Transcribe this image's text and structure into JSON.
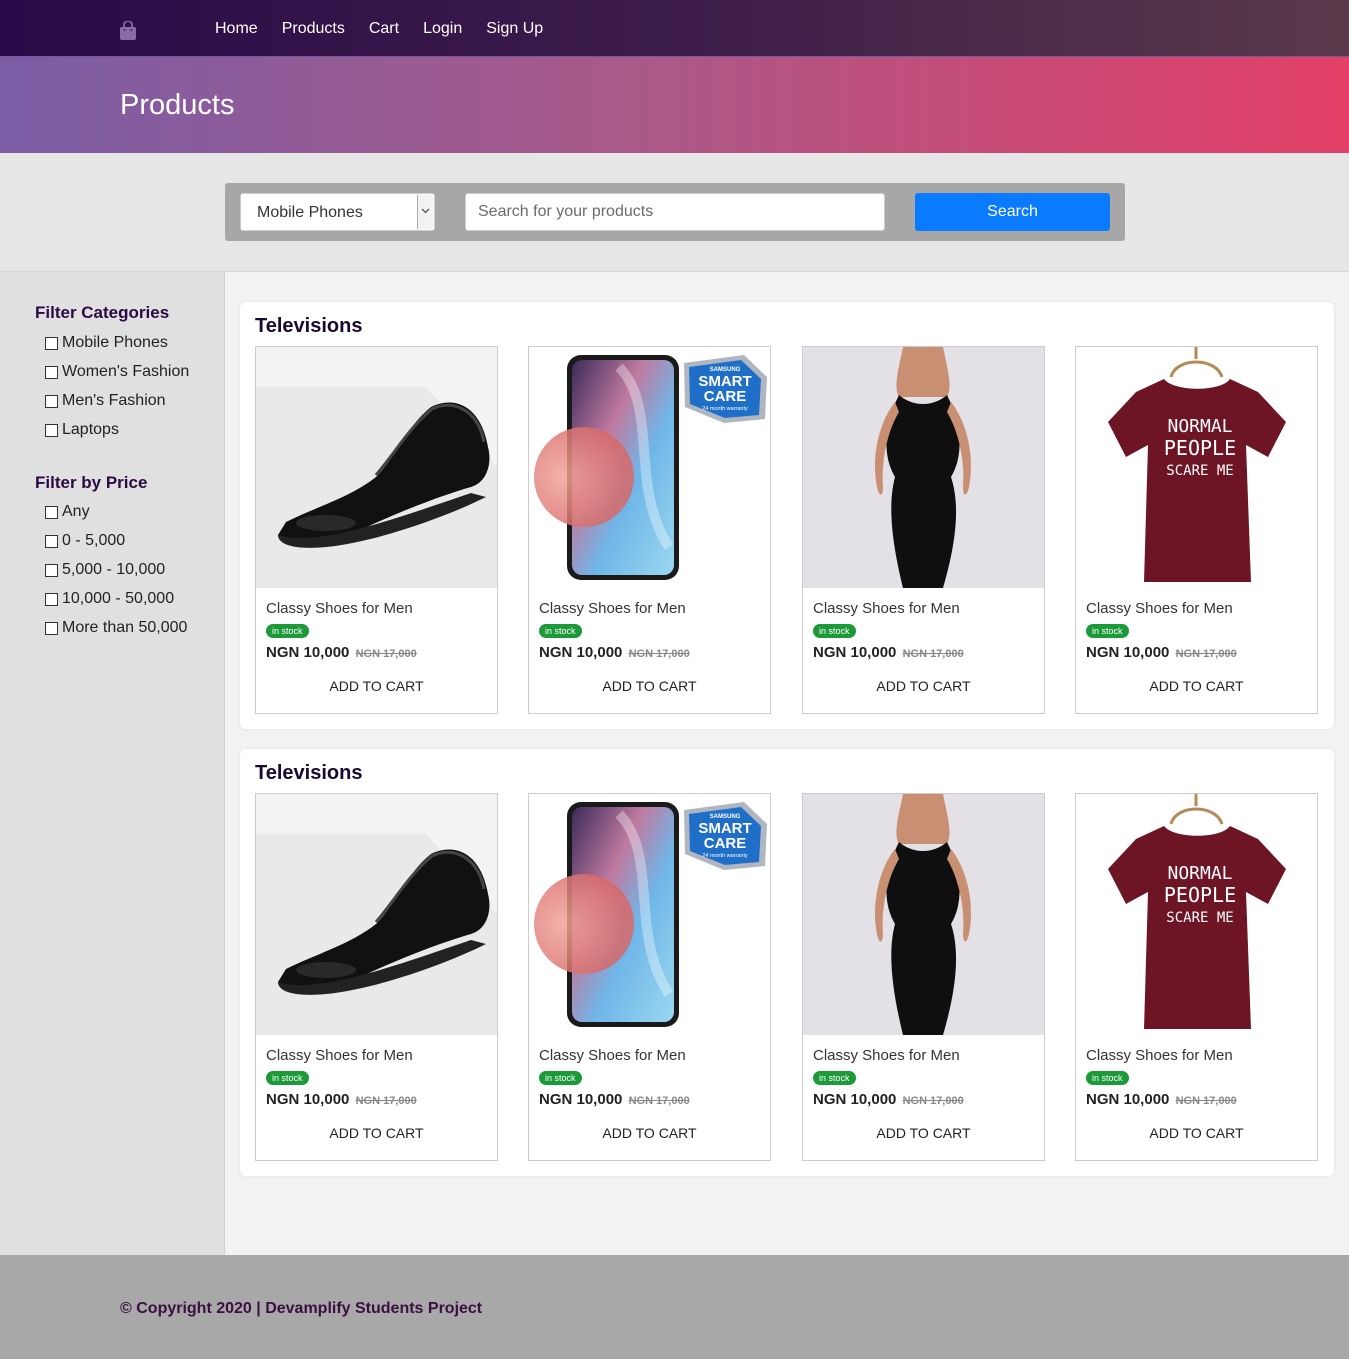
{
  "nav": {
    "logo_icon": "shopping-bag-icon",
    "links": [
      "Home",
      "Products",
      "Cart",
      "Login",
      "Sign Up"
    ]
  },
  "hero": {
    "title": "Products"
  },
  "search": {
    "category_selected": "Mobile Phones",
    "placeholder": "Search for your products",
    "button_label": "Search"
  },
  "sidebar": {
    "categories_title": "Filter Categories",
    "categories": [
      "Mobile Phones",
      "Women's Fashion",
      "Men's Fashion",
      "Laptops"
    ],
    "price_title": "Filter by Price",
    "prices": [
      "Any",
      "0 - 5,000",
      "5,000 - 10,000",
      "10,000 - 50,000",
      "More than 50,000"
    ]
  },
  "sections": [
    {
      "title": "Televisions",
      "products": [
        {
          "image": "black-shoe",
          "name": "Classy Shoes for Men",
          "badge": "in stock",
          "price": "NGN 10,000",
          "old_price": "NGN 17,000",
          "action": "ADD TO CART"
        },
        {
          "image": "samsung-phone",
          "name": "Classy Shoes for Men",
          "badge": "in stock",
          "price": "NGN 10,000",
          "old_price": "NGN 17,000",
          "action": "ADD TO CART"
        },
        {
          "image": "black-dress",
          "name": "Classy Shoes for Men",
          "badge": "in stock",
          "price": "NGN 10,000",
          "old_price": "NGN 17,000",
          "action": "ADD TO CART"
        },
        {
          "image": "maroon-tshirt",
          "name": "Classy Shoes for Men",
          "badge": "in stock",
          "price": "NGN 10,000",
          "old_price": "NGN 17,000",
          "action": "ADD TO CART"
        }
      ]
    },
    {
      "title": "Televisions",
      "products": [
        {
          "image": "black-shoe",
          "name": "Classy Shoes for Men",
          "badge": "in stock",
          "price": "NGN 10,000",
          "old_price": "NGN 17,000",
          "action": "ADD TO CART"
        },
        {
          "image": "samsung-phone",
          "name": "Classy Shoes for Men",
          "badge": "in stock",
          "price": "NGN 10,000",
          "old_price": "NGN 17,000",
          "action": "ADD TO CART"
        },
        {
          "image": "black-dress",
          "name": "Classy Shoes for Men",
          "badge": "in stock",
          "price": "NGN 10,000",
          "old_price": "NGN 17,000",
          "action": "ADD TO CART"
        },
        {
          "image": "maroon-tshirt",
          "name": "Classy Shoes for Men",
          "badge": "in stock",
          "price": "NGN 10,000",
          "old_price": "NGN 17,000",
          "action": "ADD TO CART"
        }
      ]
    }
  ],
  "phone_badge": {
    "line1": "SAMSUNG",
    "line2": "SMART",
    "line3": "CARE",
    "line4": "24 month warranty"
  },
  "tshirt_print": {
    "line1": "NORMAL",
    "line2": "PEOPLE",
    "line3": "SCARE ME"
  },
  "footer": {
    "text": "© Copyright 2020 | Devamplify Students Project"
  },
  "colors": {
    "nav": "#2a0a48",
    "hero_end": "#e44068",
    "search_button": "#0a7bff",
    "badge": "#1c9a3a"
  }
}
